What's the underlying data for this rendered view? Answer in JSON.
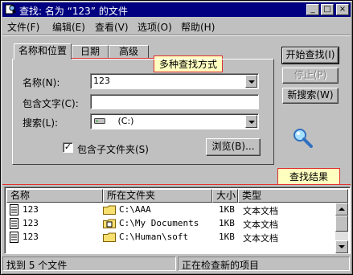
{
  "window": {
    "title": "查找: 名为 “123” 的文件",
    "controls": {
      "minimize": "_",
      "maximize": "□",
      "close": "×"
    }
  },
  "menu": [
    {
      "label": "文件(F)"
    },
    {
      "label": "编辑(E)"
    },
    {
      "label": "查看(V)"
    },
    {
      "label": "选项(O)"
    },
    {
      "label": "帮助(H)"
    }
  ],
  "tabs": [
    {
      "label": "名称和位置",
      "active": true
    },
    {
      "label": "日期",
      "active": false
    },
    {
      "label": "高级",
      "active": false
    }
  ],
  "callouts": {
    "search_methods": "多种查找方式",
    "search_results": "查找结果"
  },
  "form": {
    "name_label": "名称(N):",
    "name_value": "123",
    "contains_label": "包含文字(C):",
    "contains_value": "",
    "search_in_label": "搜索(L):",
    "search_in_value": "(C:)",
    "subfolders_label": "包含子文件夹(S)",
    "subfolders_checked": true,
    "browse_label": "浏览(B)..."
  },
  "actions": {
    "find_now": "开始查找(I)",
    "stop": "停止(P)",
    "new_search": "新搜索(W)"
  },
  "results": {
    "columns": [
      "名称",
      "所在文件夹",
      "大小",
      "类型"
    ],
    "rows": [
      {
        "name": "123",
        "folder": "C:\\AAA",
        "size": "1KB",
        "type": "文本文档"
      },
      {
        "name": "123",
        "folder": "C:\\My Documents",
        "size": "1KB",
        "type": "文本文档"
      },
      {
        "name": "123",
        "folder": "C:\\Human\\soft",
        "size": "1KB",
        "type": "文本文档"
      }
    ]
  },
  "status": {
    "count": "找到 5 个文件",
    "state": "正在检查新的项目"
  },
  "colors": {
    "titlebar": "#000080",
    "face": "#c0c0c0",
    "callout_border": "#e03030",
    "callout_bg": "#ffffc0"
  }
}
